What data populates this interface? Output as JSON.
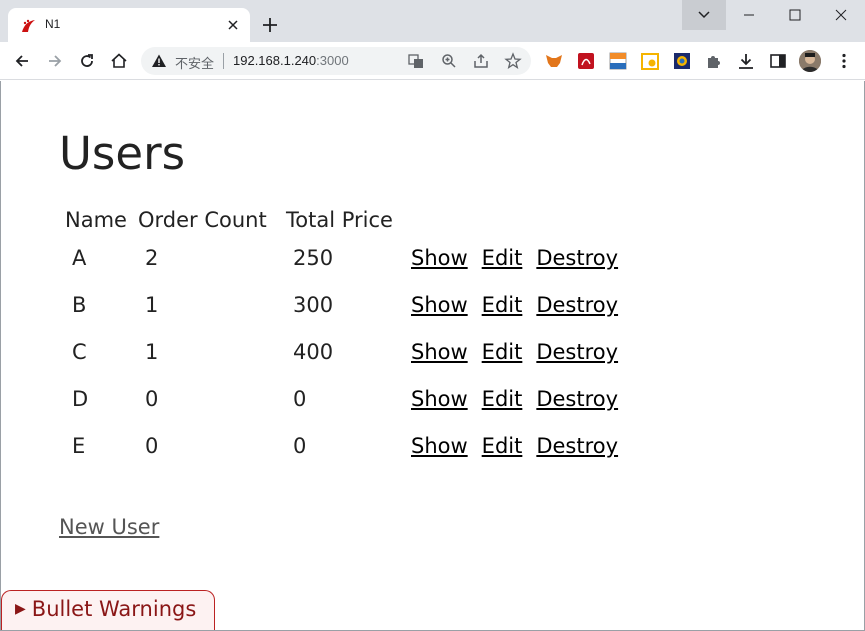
{
  "browser": {
    "tab_title": "N1",
    "address": {
      "security_label": "不安全",
      "host": "192.168.1.240",
      "port": ":3000"
    }
  },
  "page": {
    "title": "Users",
    "table": {
      "headers": [
        "Name",
        "Order Count",
        "Total Price"
      ],
      "rows": [
        {
          "name": "A",
          "order_count": "2",
          "total_price": "250"
        },
        {
          "name": "B",
          "order_count": "1",
          "total_price": "300"
        },
        {
          "name": "C",
          "order_count": "1",
          "total_price": "400"
        },
        {
          "name": "D",
          "order_count": "0",
          "total_price": "0"
        },
        {
          "name": "E",
          "order_count": "0",
          "total_price": "0"
        }
      ],
      "actions": {
        "show": "Show",
        "edit": "Edit",
        "destroy": "Destroy"
      }
    },
    "new_user_link": "New User",
    "bullet_warnings": "Bullet Warnings"
  },
  "colors": {
    "titlebar": "#dee1e6",
    "bullet_border": "#bb2222",
    "bullet_text": "#8a1616"
  }
}
